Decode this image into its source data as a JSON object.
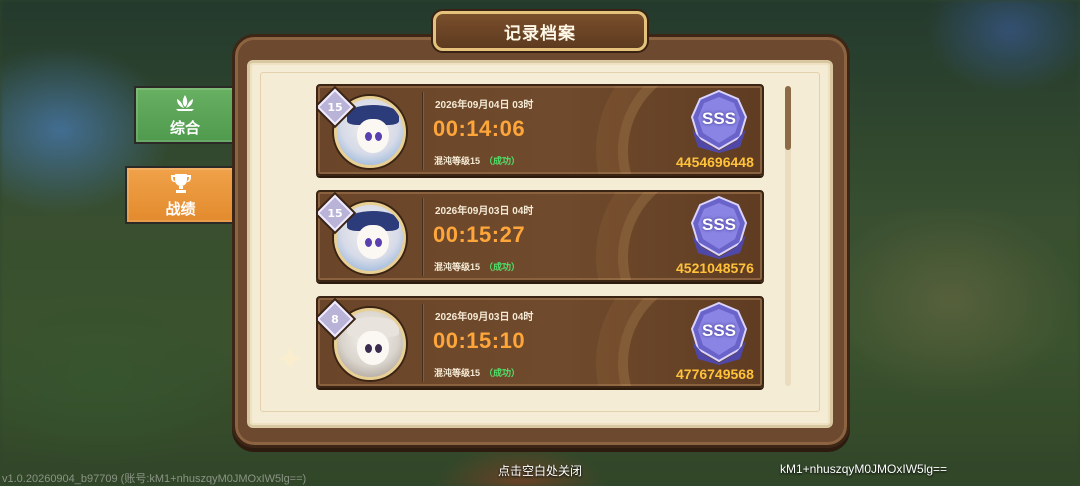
{
  "title": "记录档案",
  "tabs": [
    {
      "label": "综合",
      "icon": "lotus-icon",
      "active": false
    },
    {
      "label": "战绩",
      "icon": "trophy-icon",
      "active": true
    }
  ],
  "records": [
    {
      "level": "15",
      "date": "2026年09月04日 03时",
      "time": "00:14:06",
      "difficulty": "混沌等级15",
      "status": "（成功）",
      "rank": "SSS",
      "score": "4454696448"
    },
    {
      "level": "15",
      "date": "2026年09月03日 04时",
      "time": "00:15:27",
      "difficulty": "混沌等级15",
      "status": "（成功）",
      "rank": "SSS",
      "score": "4521048576"
    },
    {
      "level": "8",
      "date": "2026年09月03日 04时",
      "time": "00:15:10",
      "difficulty": "混沌等级15",
      "status": "（成功）",
      "rank": "SSS",
      "score": "4776749568"
    }
  ],
  "scroll_position": 0.1,
  "close_hint": "点击空白处关闭",
  "version": "v1.0.20260904_b97709 (账号:kM1+nhuszqyM0JMOxIW5lg==)",
  "account_id": "kM1+nhuszqyM0JMOxIW5lg==",
  "colors": {
    "time": "#ffa63a",
    "score": "#ffc23a",
    "success": "#4fe06a",
    "tab_general": "#5aa356",
    "tab_record": "#e8912f"
  }
}
